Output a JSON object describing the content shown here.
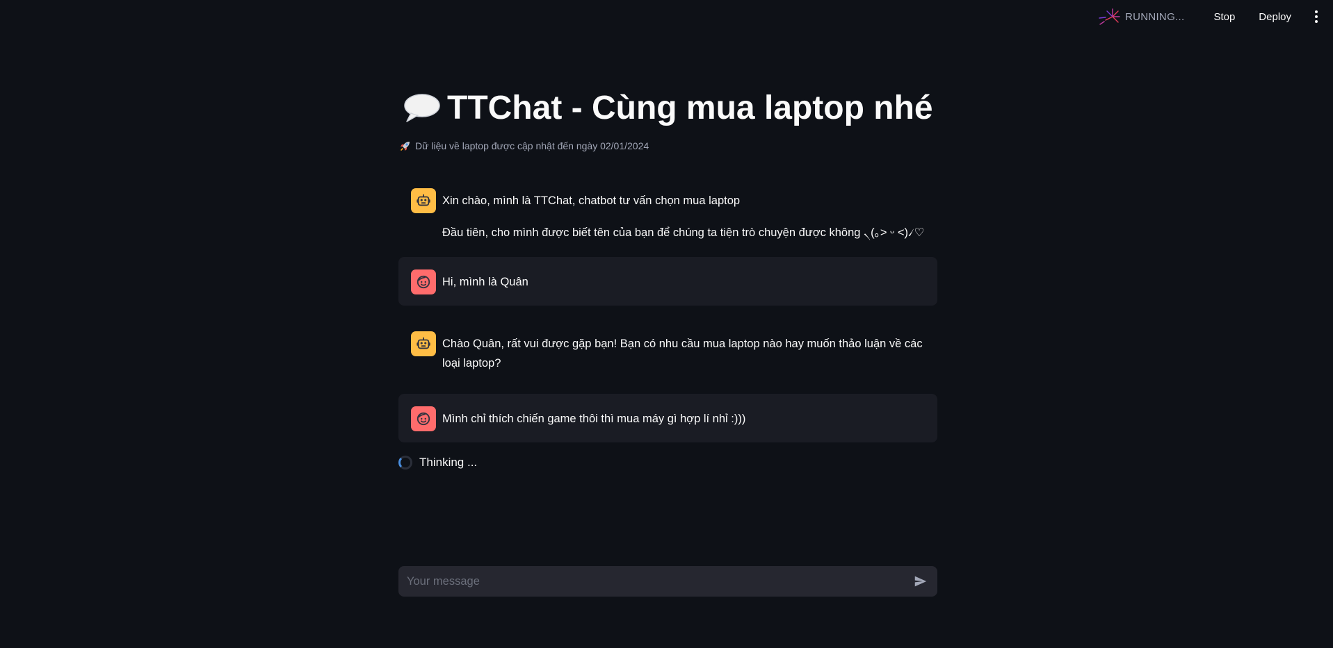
{
  "toolbar": {
    "status": "RUNNING...",
    "stop_label": "Stop",
    "deploy_label": "Deploy",
    "menu_icon": "kebab-menu-icon",
    "status_icon": "running-activity-icon"
  },
  "header": {
    "title_icon": "speech-balloon-icon",
    "title": "TTChat - Cùng mua laptop nhé",
    "caption_icon": "rocket-icon",
    "caption": "Dữ liệu về laptop được cập nhật đến ngày 02/01/2024"
  },
  "messages": [
    {
      "role": "assistant",
      "avatar_icon": "robot-icon",
      "lines": [
        "Xin chào, mình là TTChat, chatbot tư vấn chọn mua laptop",
        "Đầu tiên, cho mình được biết tên của bạn để chúng ta tiện trò chuyện được không ৲(｡˃ ᵕ ˂)৴♡"
      ]
    },
    {
      "role": "user",
      "avatar_icon": "smiling-face-icon",
      "lines": [
        "Hi, mình là Quân"
      ]
    },
    {
      "role": "assistant",
      "avatar_icon": "robot-icon",
      "lines": [
        "Chào Quân, rất vui được gặp bạn! Bạn có nhu cầu mua laptop nào hay muốn thảo luận về các loại laptop?"
      ]
    },
    {
      "role": "user",
      "avatar_icon": "smiling-face-icon",
      "lines": [
        "Mình chỉ thích chiến game thôi thì mua máy gì hợp lí nhỉ :)))"
      ]
    }
  ],
  "status": {
    "thinking_label": "Thinking ..."
  },
  "chat_input": {
    "placeholder": "Your message",
    "value": "",
    "send_icon": "send-icon"
  },
  "colors": {
    "background": "#0e1117",
    "user_message_bg": "#1a1c24",
    "input_bg": "#262730",
    "bot_avatar": "#ffbd45",
    "user_avatar": "#ff6c6c"
  }
}
